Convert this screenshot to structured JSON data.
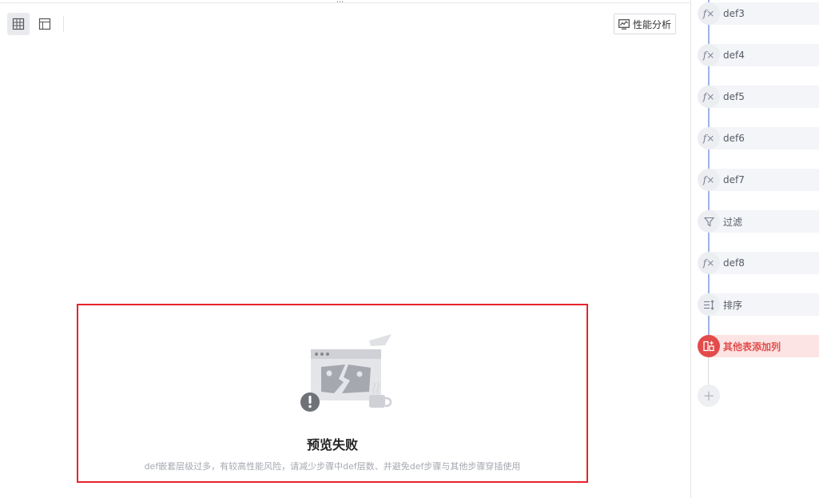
{
  "toolbar": {
    "drag_handle": "⋯",
    "perf_button_label": "性能分析"
  },
  "preview_error": {
    "title": "预览失败",
    "description": "def嵌套层级过多，有较高性能风险，请减少步骤中def层数、并避免def步骤与其他步骤穿插使用"
  },
  "steps": [
    {
      "icon": "fx-icon",
      "label": "def3"
    },
    {
      "icon": "fx-icon",
      "label": "def4"
    },
    {
      "icon": "fx-icon",
      "label": "def5"
    },
    {
      "icon": "fx-icon",
      "label": "def6"
    },
    {
      "icon": "fx-icon",
      "label": "def7"
    },
    {
      "icon": "filter-icon",
      "label": "过滤"
    },
    {
      "icon": "fx-icon",
      "label": "def8"
    },
    {
      "icon": "sort-icon",
      "label": "排序"
    },
    {
      "icon": "add-column-icon",
      "label": "其他表添加列",
      "active": true
    }
  ],
  "colors": {
    "error_border": "#e8242b",
    "active_step": "#e24c4b",
    "timeline": "#9fb4e6"
  }
}
